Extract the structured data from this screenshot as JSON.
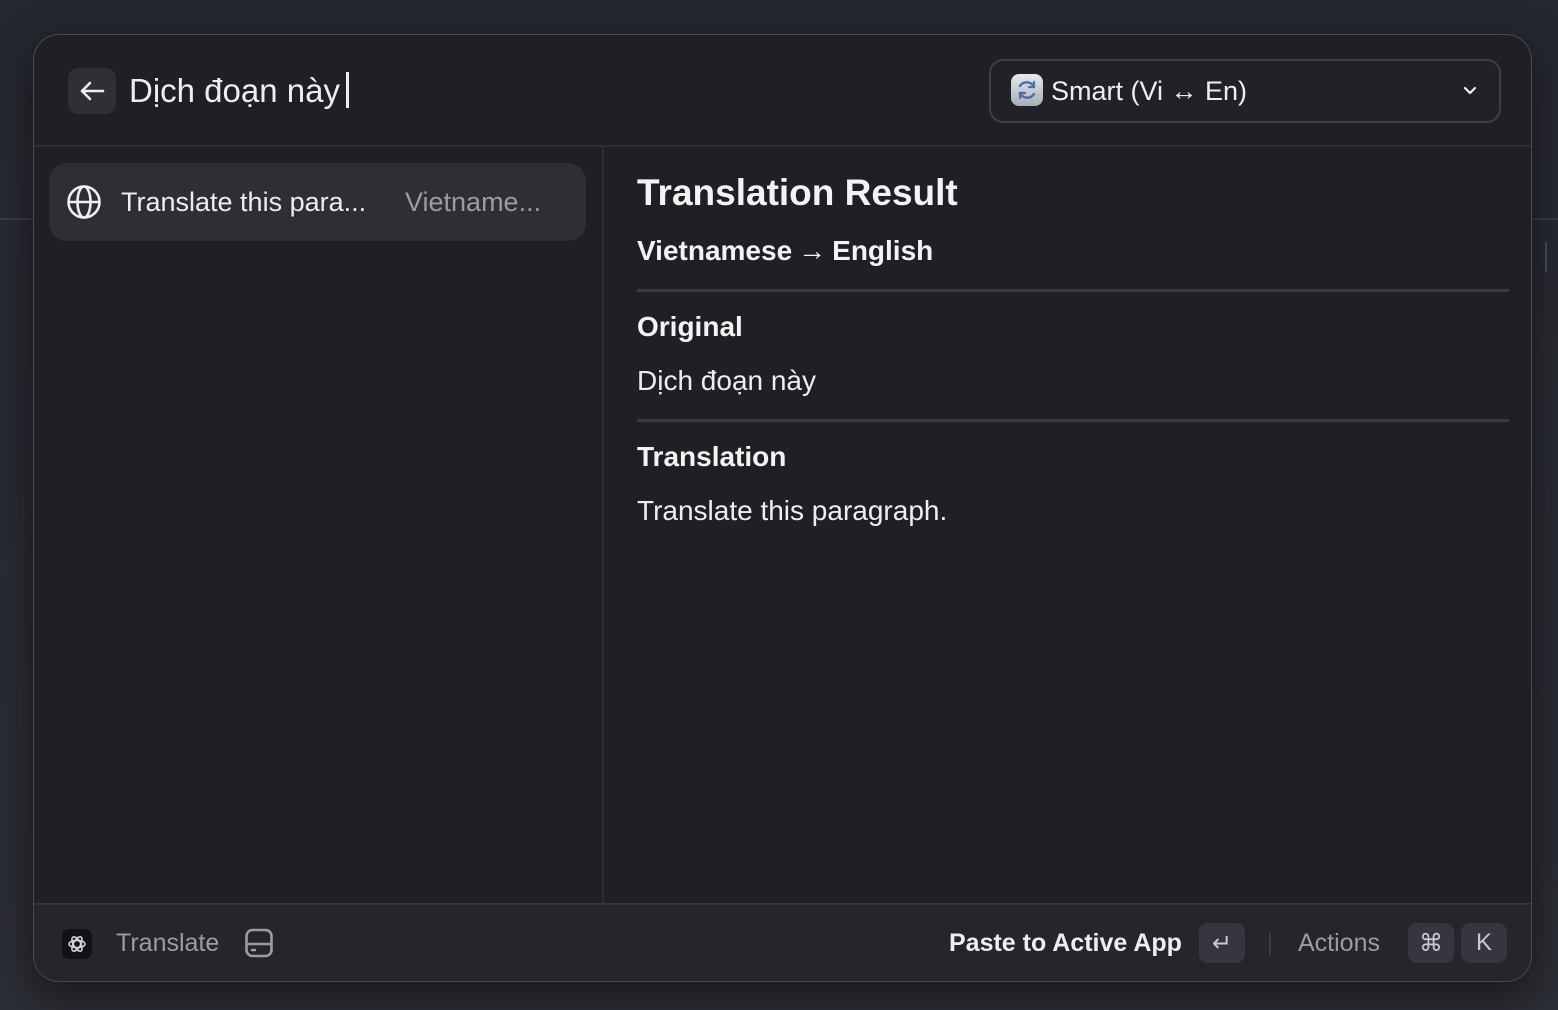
{
  "header": {
    "search_text": "Dịch đoạn này",
    "mode_label": "Smart (Vi ↔ En)"
  },
  "list": {
    "items": [
      {
        "title": "Translate this para...",
        "subtitle": "Vietname..."
      }
    ]
  },
  "result": {
    "title": "Translation Result",
    "source_lang": "Vietnamese",
    "arrow": "→",
    "target_lang": "English",
    "original_label": "Original",
    "original_text": "Dịch đoạn này",
    "translation_label": "Translation",
    "translation_text": "Translate this paragraph."
  },
  "footer": {
    "command_label": "Translate",
    "primary_action": "Paste to Active App",
    "primary_key": "↵",
    "actions_label": "Actions",
    "actions_key_1": "⌘",
    "actions_key_2": "K"
  },
  "icons": {
    "back": "arrow-left-icon",
    "mode": "refresh-app-icon",
    "chevron": "chevron-down-icon",
    "globe": "globe-icon",
    "ai": "openai-icon",
    "drive": "drive-icon"
  },
  "colors": {
    "window_bg": "#1f2024",
    "selected_item_bg": "#2e2f35",
    "text_primary": "#eceef1",
    "text_secondary": "#9a9ca4"
  }
}
